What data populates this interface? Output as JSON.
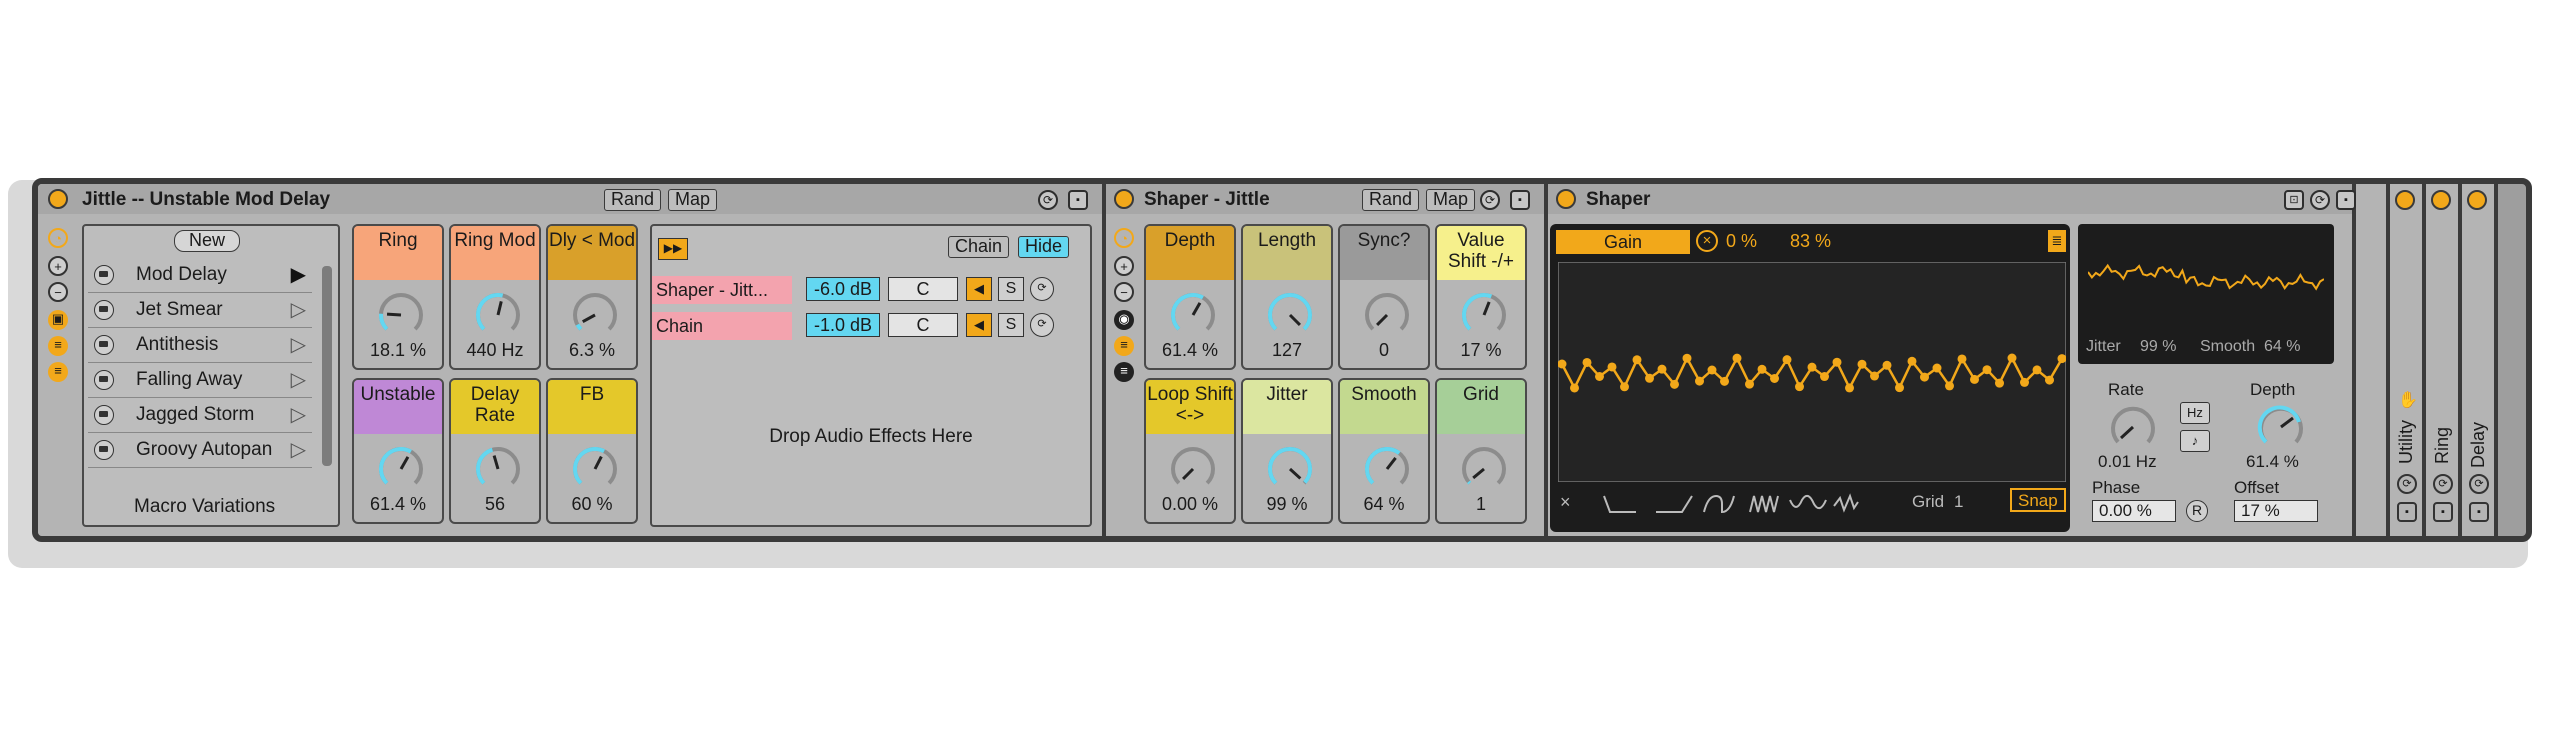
{
  "rack": {
    "title": "Jittle -- Unstable Mod Delay",
    "rand_label": "Rand",
    "map_label": "Map",
    "new_label": "New",
    "variations": [
      "Mod Delay",
      "Jet Smear",
      "Antithesis",
      "Falling Away",
      "Jagged Storm",
      "Groovy Autopan"
    ],
    "variations_title": "Macro Variations",
    "macros": [
      {
        "label": "Ring",
        "value": "18.1 %",
        "color": "#f7a57a",
        "level": 0.18
      },
      {
        "label": "Ring Mod",
        "value": "440 Hz",
        "color": "#f7a57a",
        "level": 0.55
      },
      {
        "label": "Dly < Mod",
        "value": "6.3 %",
        "color": "#d9a02a",
        "level": 0.06
      },
      {
        "label": "Unstable",
        "value": "61.4 %",
        "color": "#bf88d6",
        "level": 0.61
      },
      {
        "label": "Delay Rate",
        "value": "56",
        "color": "#e4c82a",
        "level": 0.44
      },
      {
        "label": "FB",
        "value": "60 %",
        "color": "#e4c82a",
        "level": 0.6
      }
    ],
    "chain_label": "Chain",
    "hide_label": "Hide",
    "chains": [
      {
        "name": "Shaper - Jitt...",
        "db": "-6.0 dB",
        "pan": "C",
        "mute": "◀",
        "solo": "S"
      },
      {
        "name": "Chain",
        "db": "-1.0 dB",
        "pan": "C",
        "mute": "◀",
        "solo": "S"
      }
    ],
    "drop_text": "Drop Audio Effects Here"
  },
  "shaper_rack": {
    "title": "Shaper - Jittle",
    "rand_label": "Rand",
    "map_label": "Map",
    "macros": [
      {
        "label": "Depth",
        "value": "61.4 %",
        "color": "#d9a02a",
        "level": 0.61
      },
      {
        "label": "Length",
        "value": "127",
        "color": "#c9c27a",
        "level": 1.0
      },
      {
        "label": "Sync?",
        "value": "0",
        "color": "#9a9a9a",
        "level": 0.0
      },
      {
        "label": "Value Shift -/+",
        "value": "17 %",
        "color": "#f6f08c",
        "level": 0.58
      },
      {
        "label": "Loop Shift <->",
        "value": "0.00 %",
        "color": "#e4c82a",
        "level": 0.0
      },
      {
        "label": "Jitter",
        "value": "99 %",
        "color": "#dbe6a0",
        "level": 0.99
      },
      {
        "label": "Smooth",
        "value": "64 %",
        "color": "#c3d98f",
        "level": 0.64
      },
      {
        "label": "Grid",
        "value": "1",
        "color": "#a6cf98",
        "level": 0.02
      }
    ]
  },
  "shaper": {
    "title": "Shaper",
    "gain_label": "Gain",
    "value1": "0 %",
    "value2": "83 %",
    "grid_label": "Grid",
    "grid_value": "1",
    "snap_label": "Snap",
    "close_glyph": "×",
    "jitter_label": "Jitter",
    "jitter_value": "99 %",
    "smooth_label": "Smooth",
    "smooth_value": "64 %",
    "rate_label": "Rate",
    "rate_value": "0.01 Hz",
    "hz_label": "Hz",
    "note_glyph": "♪",
    "depth_label": "Depth",
    "depth_value": "61.4 %",
    "phase_label": "Phase",
    "phase_value": "0.00 %",
    "r_label": "R",
    "offset_label": "Offset",
    "offset_value": "17 %",
    "accent_color": "#f2a81a"
  },
  "collapsed_devices": [
    "Utility",
    "Ring",
    "Delay"
  ]
}
